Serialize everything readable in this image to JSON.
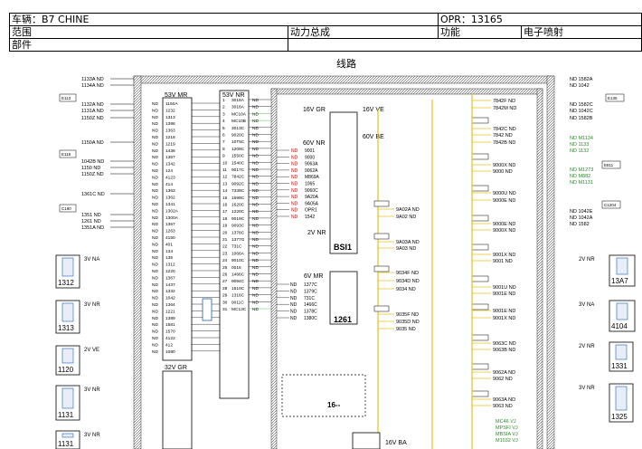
{
  "header": {
    "vehicle": "车辆：B7 CHINE",
    "opr": "OPR：13165",
    "scope_label": "范围",
    "powertrain": "动力总成",
    "function_label": "功能",
    "function_value": "电子喷射",
    "component_label": "部件",
    "diagram_title": "线路"
  },
  "components": [
    {
      "code": "1312",
      "label": "3V NA"
    },
    {
      "code": "1313",
      "label": "3V NR"
    },
    {
      "code": "1120",
      "label": "2V VE"
    },
    {
      "code": "1131",
      "label": "3V NR"
    },
    {
      "code": "BSI1",
      "label": "BSI1"
    },
    {
      "code": "1261",
      "label": "6V MR"
    },
    {
      "code": "13A7",
      "label": "2V NR"
    },
    {
      "code": "4104",
      "label": "3V NA"
    },
    {
      "code": "1331",
      "label": "2V NR"
    },
    {
      "code": "1325",
      "label": "3V NR"
    }
  ],
  "connectors": {
    "c53mr": "53V MR",
    "c53nr": "53V NR",
    "c16gr": "16V GR",
    "c16ve": "16V VE",
    "c60nr": "60V NR",
    "c60be": "60V BE",
    "c2vnr": "2V NR",
    "c32gr": "32V GR",
    "c16ba": "16V BA",
    "c16dash": "16--"
  },
  "left_wires": [
    "1133A ND",
    "1134A ND",
    "1132A ND",
    "1131A ND",
    "1150Z ND",
    "1150A ND",
    "1042B ND",
    "1150 ND",
    "1150Z ND",
    "1361C ND",
    "1351 ND",
    "1261 ND",
    "1351A ND"
  ],
  "left_pins_53mr": [
    "1150A",
    "1232",
    "1313",
    "1386",
    "1363",
    "1218",
    "1219",
    "1438",
    "1367",
    "1342",
    "124",
    "4123",
    "414",
    "1363",
    "1362",
    "1341",
    "1302A",
    "1300A",
    "1367",
    "1263",
    "4150",
    "401",
    "134",
    "135",
    "1312",
    "1220",
    "1367",
    "1437",
    "1332",
    "1042",
    "1364",
    "1221",
    "1389",
    "1581",
    "1570",
    "4122",
    "412",
    "1080"
  ],
  "right_pins_53nr": [
    "3018A",
    "3018A",
    "MC10A",
    "MC10B",
    "3013C",
    "9020C",
    "10T5C",
    "1209C",
    "1550C",
    "1540C",
    "9017C",
    "7842C",
    "9092C",
    "7339C",
    "1599C",
    "1620C",
    "1220C",
    "9019C",
    "9093C",
    "1378C",
    "1377G",
    "731C",
    "1066A",
    "9010C",
    "0016",
    "1466C",
    "9094C",
    "1510C",
    "1316C",
    "9011C",
    "MC13C"
  ],
  "middle_wires_60nr": [
    "9001",
    "9000",
    "9063A",
    "9062A",
    "M869A",
    "1065",
    "9060C",
    "9A20A",
    "9A05A",
    "OPR1",
    "1542"
  ],
  "middle_wires_6vmr": [
    "1377C",
    "1379C",
    "731C",
    "1466C",
    "1378C",
    "1380C"
  ],
  "right_mid_wires": [
    "9A02A ND",
    "9A02 ND",
    "9A03A ND",
    "9A03 ND",
    "9034F ND",
    "9034D ND",
    "9034 ND",
    "9035F ND",
    "9035D ND",
    "9035 ND"
  ],
  "right_col_wires": [
    "7842F ND",
    "7842M ND",
    "7842C ND",
    "7842 ND",
    "7842B ND",
    "9000X ND",
    "9000 ND",
    "9000U ND",
    "9000E ND",
    "9000E ND",
    "9000X ND",
    "9001X ND",
    "9001 ND",
    "9001U ND",
    "9001E ND",
    "9001E ND",
    "9001X ND",
    "9063C ND",
    "9063B ND",
    "9062A ND",
    "9062 ND",
    "9063A ND",
    "9063 ND"
  ],
  "far_right_wires": [
    "ND 1582A",
    "ND 1042",
    "ND 1582C",
    "ND 1042C",
    "ND 1582B",
    "ND M1134",
    "ND 1133",
    "ND 1132",
    "ND M1273",
    "ND M882",
    "ND M1131",
    "ND 1042E",
    "ND 1042A",
    "ND 1582"
  ],
  "bottom_labels": [
    "MC46 VJ",
    "MPSFI VJ",
    "MBSIA VJ",
    "M1032 VJ"
  ]
}
